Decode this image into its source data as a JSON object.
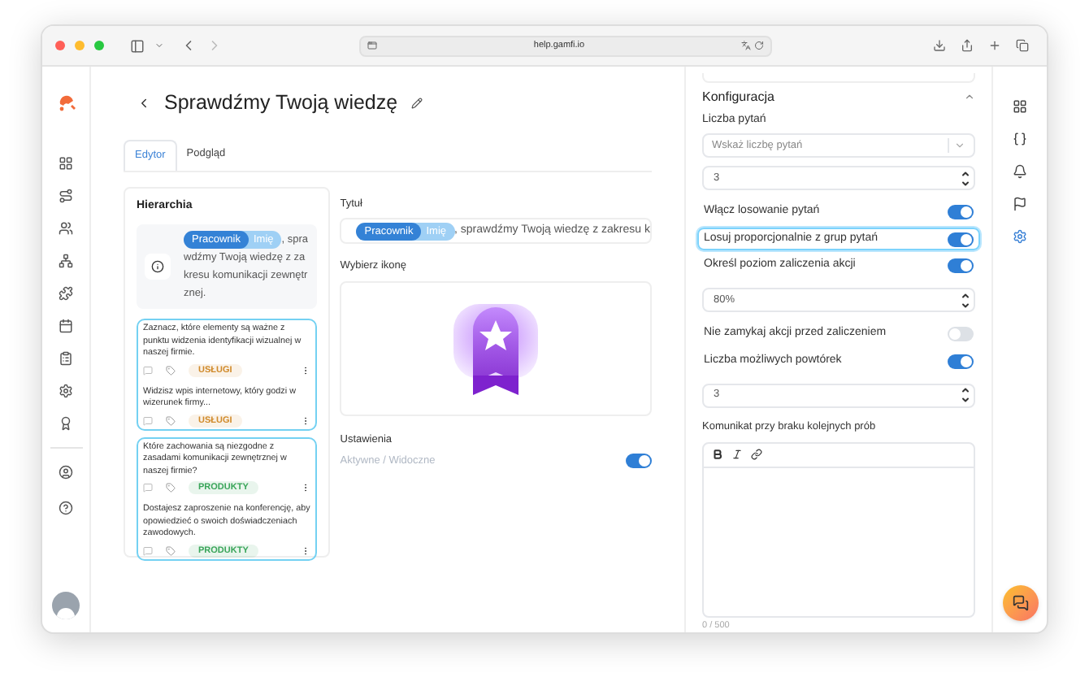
{
  "browser": {
    "url": "help.gamfi.io"
  },
  "header": {
    "title": "Sprawdźmy Twoją wiedzę"
  },
  "tabs": [
    {
      "label": "Edytor",
      "selected": true
    },
    {
      "label": "Podgląd",
      "selected": false
    }
  ],
  "hierarchy": {
    "title": "Hierarchia",
    "intro": {
      "chips": [
        "Pracownik",
        "Imię"
      ],
      "text": ", sprawdźmy Twoją wiedzę z zakresu komunikacji zewnętrznej."
    },
    "groups": [
      {
        "items": [
          {
            "text": "Zaznacz, które elementy są ważne z punktu widzenia identyfikacji wizualnej w naszej firmie.",
            "tag": "USŁUGI",
            "color": "#d08a2a"
          },
          {
            "text": "Widzisz wpis internetowy, który godzi w wizerunek firmy...",
            "tag": "USŁUGI",
            "color": "#d08a2a"
          }
        ]
      },
      {
        "items": [
          {
            "text": "Które zachowania są niezgodne z zasadami komunikacji zewnętrznej w naszej firmie?",
            "tag": "PRODUKTY",
            "color": "#3aa55a"
          },
          {
            "text": "Dostajesz zaproszenie na konferencję, aby opowiedzieć o swoich doświadczeniach zawodowych.",
            "tag": "PRODUKTY",
            "color": "#3aa55a"
          }
        ]
      }
    ]
  },
  "title_field": {
    "label": "Tytuł",
    "chips": [
      "Pracownik",
      "Imię"
    ],
    "text": ", sprawdźmy Twoją wiedzę z zakresu k"
  },
  "icon_picker": {
    "label": "Wybierz ikonę"
  },
  "settings": {
    "label": "Ustawienia",
    "toggle": {
      "label": "Aktywne / Widoczne",
      "on": true
    }
  },
  "config": {
    "title": "Konfiguracja",
    "expanded": true,
    "rows": [
      {
        "kind": "label",
        "text": "Liczba pytań"
      },
      {
        "kind": "select",
        "placeholder": "Wskaż liczbę pytań"
      },
      {
        "kind": "number",
        "value": "3"
      },
      {
        "kind": "toggle",
        "label": "Włącz losowanie pytań",
        "on": true,
        "focused": false
      },
      {
        "kind": "toggle",
        "label": "Losuj proporcjonalnie z grup pytań",
        "on": true,
        "focused": true
      },
      {
        "kind": "toggle",
        "label": "Określ poziom zaliczenia akcji",
        "on": true,
        "focused": false
      },
      {
        "kind": "number",
        "value": "80%"
      },
      {
        "kind": "toggle",
        "label": "Nie zamykaj akcji przed zaliczeniem",
        "on": false,
        "focused": false
      },
      {
        "kind": "toggle",
        "label": "Liczba możliwych powtórek",
        "on": true,
        "focused": false
      },
      {
        "kind": "number",
        "value": "3"
      },
      {
        "kind": "editor",
        "label": "Komunikat przy braku kolejnych prób",
        "counter": "0 / 500"
      }
    ]
  }
}
